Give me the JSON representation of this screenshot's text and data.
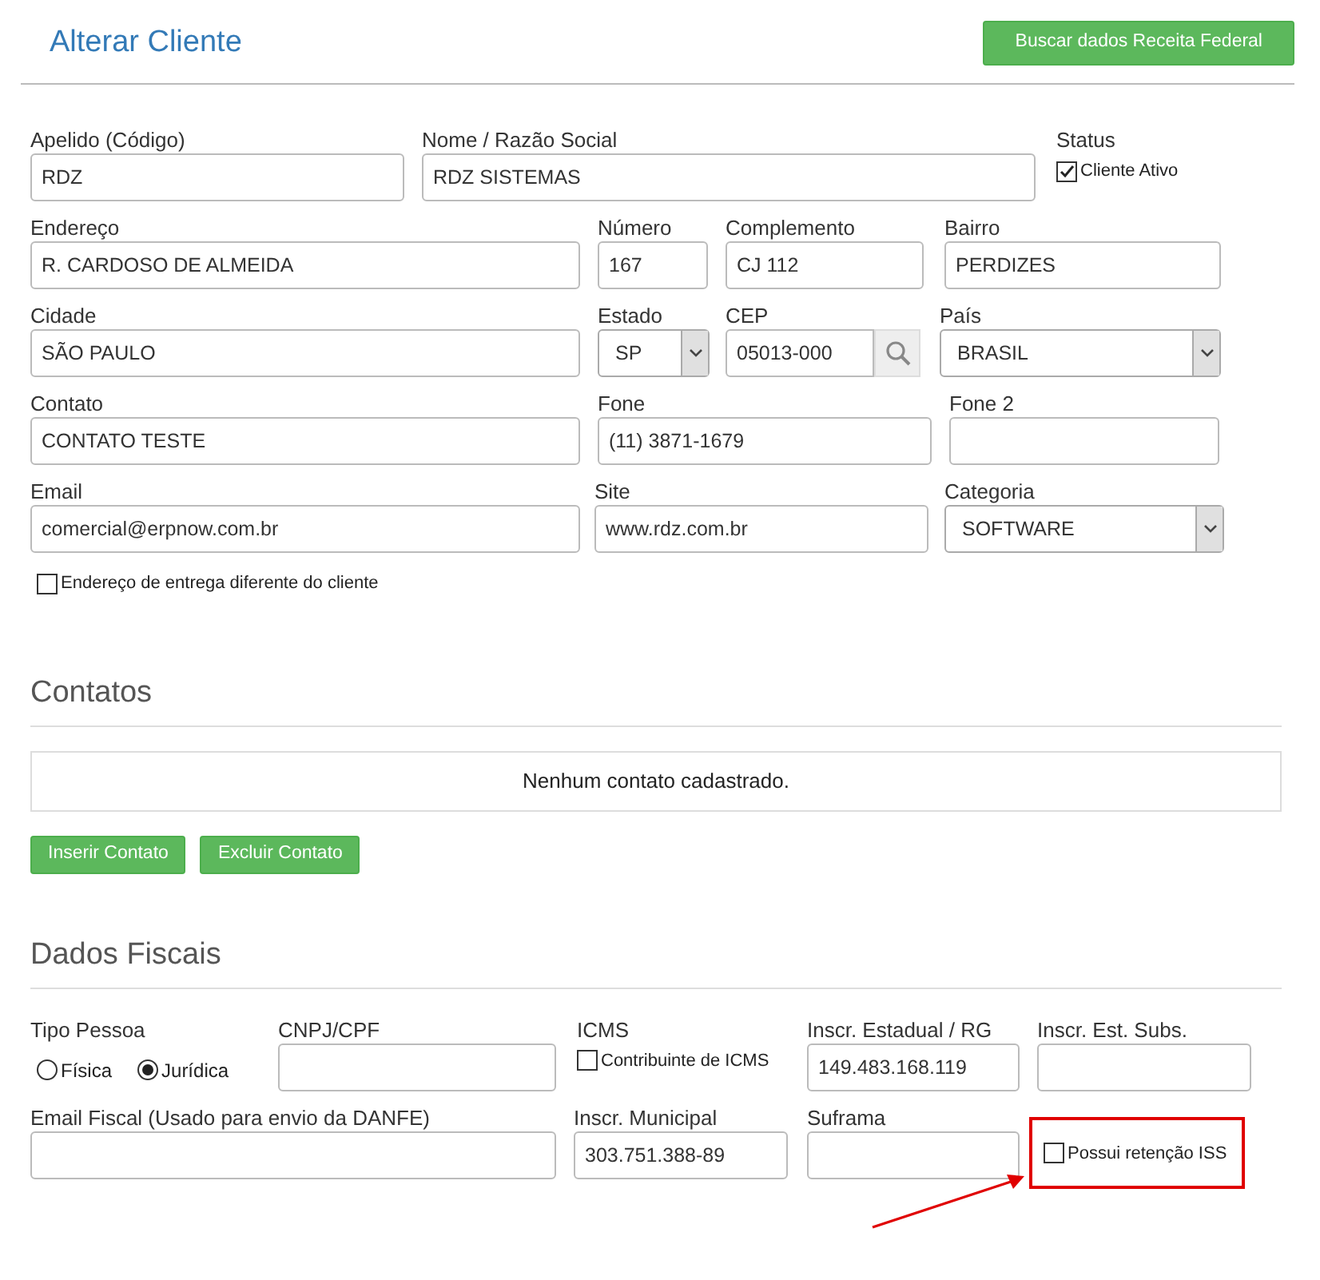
{
  "header": {
    "title": "Alterar Cliente",
    "button": "Buscar dados Receita Federal"
  },
  "client_form": {
    "rows": [
      [
        {
          "kind": "text",
          "label": "Apelido (Código)",
          "value": "RDZ"
        },
        {
          "kind": "text",
          "label": "Nome / Razão Social",
          "value": "RDZ SISTEMAS"
        },
        {
          "kind": "checkbox",
          "label": "Status",
          "option": "Cliente Ativo",
          "checked": true
        }
      ],
      [
        {
          "kind": "text",
          "label": "Endereço",
          "value": "R. CARDOSO DE ALMEIDA"
        },
        {
          "kind": "text",
          "label": "Número",
          "value": "167"
        },
        {
          "kind": "text",
          "label": "Complemento",
          "value": "CJ 112"
        },
        {
          "kind": "text",
          "label": "Bairro",
          "value": "PERDIZES"
        }
      ],
      [
        {
          "kind": "text",
          "label": "Cidade",
          "value": "SÃO PAULO"
        },
        {
          "kind": "select",
          "label": "Estado",
          "value": "SP"
        },
        {
          "kind": "cep",
          "label": "CEP",
          "value": "05013-000"
        },
        {
          "kind": "select",
          "label": "País",
          "value": "BRASIL"
        }
      ],
      [
        {
          "kind": "text",
          "label": "Contato",
          "value": "CONTATO TESTE"
        },
        {
          "kind": "text",
          "label": "Fone",
          "value": "(11) 3871-1679"
        },
        {
          "kind": "text",
          "label": "Fone 2"
        }
      ],
      [
        {
          "kind": "text",
          "label": "Email",
          "value": "comercial@erpnow.com.br"
        },
        {
          "kind": "text",
          "label": "Site",
          "value": "www.rdz.com.br"
        },
        {
          "kind": "select",
          "label": "Categoria",
          "value": "SOFTWARE"
        }
      ]
    ],
    "delivery_checkbox": {
      "option": "Endereço de entrega diferente do cliente",
      "checked": false
    }
  },
  "contatos": {
    "title": "Contatos",
    "empty_message": "Nenhum contato cadastrado.",
    "buttons": [
      "Inserir Contato",
      "Excluir Contato"
    ]
  },
  "dados_fiscais": {
    "title": "Dados Fiscais",
    "fields": [
      {
        "kind": "radio",
        "label": "Tipo Pessoa",
        "options": [
          {
            "label": "Física",
            "selected": false
          },
          {
            "label": "Jurídica",
            "selected": true
          }
        ]
      },
      {
        "kind": "text",
        "label": "CNPJ/CPF"
      },
      {
        "kind": "checkbox",
        "label": "ICMS",
        "option": "Contribuinte de ICMS",
        "checked": false
      },
      {
        "kind": "text",
        "label": "Inscr. Estadual / RG",
        "value": "149.483.168.119"
      },
      {
        "kind": "text",
        "label": "Inscr. Est. Subs."
      },
      {
        "kind": "text",
        "label": "Email Fiscal (Usado para envio da DANFE)"
      },
      {
        "kind": "text",
        "label": "Inscr. Municipal",
        "value": "303.751.388-89"
      },
      {
        "kind": "text",
        "label": "Suframa"
      },
      {
        "kind": "checkbox",
        "option": "Possui retenção ISS",
        "checked": false,
        "highlighted": true
      }
    ]
  }
}
